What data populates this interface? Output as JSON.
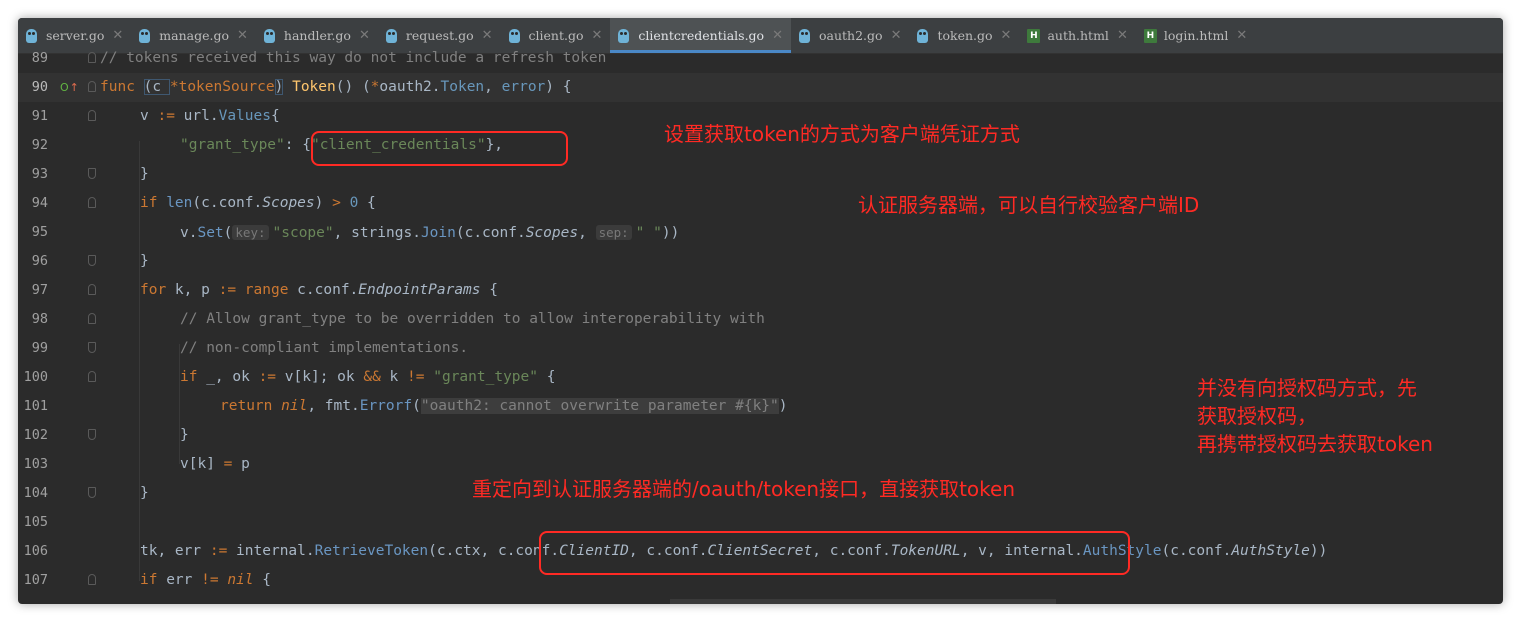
{
  "tabs": [
    {
      "label": "server.go",
      "type": "go"
    },
    {
      "label": "manage.go",
      "type": "go"
    },
    {
      "label": "handler.go",
      "type": "go"
    },
    {
      "label": "request.go",
      "type": "go"
    },
    {
      "label": "client.go",
      "type": "go"
    },
    {
      "label": "clientcredentials.go",
      "type": "go",
      "active": true
    },
    {
      "label": "oauth2.go",
      "type": "go"
    },
    {
      "label": "token.go",
      "type": "go"
    },
    {
      "label": "auth.html",
      "type": "html"
    },
    {
      "label": "login.html",
      "type": "html"
    }
  ],
  "tab_close_glyph": "✕",
  "lines": {
    "n89": "89",
    "n90": "90",
    "n91": "91",
    "n92": "92",
    "n93": "93",
    "n94": "94",
    "n95": "95",
    "n96": "96",
    "n97": "97",
    "n98": "98",
    "n99": "99",
    "n100": "100",
    "n101": "101",
    "n102": "102",
    "n103": "103",
    "n104": "104",
    "n105": "105",
    "n106": "106",
    "n107": "107"
  },
  "code": {
    "l89_comment": "// tokens received this way do not include a refresh token",
    "l90_func": "func",
    "l90_recv_open": "(c ",
    "l90_star": "*",
    "l90_recv_type": "tokenSource",
    "l90_recv_close": ")",
    "l90_name": "Token",
    "l90_rest_a": "() (",
    "l90_star2": "*",
    "l90_pkg": "oauth2.",
    "l90_type": "Token",
    "l90_rest_b": ", ",
    "l90_err": "error",
    "l90_rest_c": ") {",
    "l91_a": "v ",
    "l91_op": ":=",
    "l91_b": " url.",
    "l91_type": "Values",
    "l91_c": "{",
    "l92_key": "\"grant_type\"",
    "l92_colon": ": ",
    "l92_val_open": "{",
    "l92_val": "\"client_credentials\"",
    "l92_val_close": "},",
    "l93": "}",
    "l94_if": "if ",
    "l94_len": "len",
    "l94_a": "(c.conf.",
    "l94_scopes": "Scopes",
    "l94_b": ") ",
    "l94_gt": ">",
    "l94_zero": " 0",
    "l94_c": " {",
    "l95_a": "v.",
    "l95_set": "Set",
    "l95_b": "(",
    "l95_hint_key": "key:",
    "l95_scope": "\"scope\"",
    "l95_c": ", strings.",
    "l95_join": "Join",
    "l95_d": "(c.conf.",
    "l95_scopes": "Scopes",
    "l95_e": ", ",
    "l95_hint_sep": "sep:",
    "l95_space": "\" \"",
    "l95_f": "))",
    "l96": "}",
    "l97_for": "for",
    "l97_a": " k, p ",
    "l97_op": ":=",
    "l97_range": " range",
    "l97_b": " c.conf.",
    "l97_ep": "EndpointParams",
    "l97_c": " {",
    "l98": "// Allow grant_type to be overridden to allow interoperability with",
    "l99": "// non-compliant implementations.",
    "l100_if": "if",
    "l100_a": " _, ok ",
    "l100_op": ":=",
    "l100_b": " v[k]; ok ",
    "l100_and": "&&",
    "l100_c": " k ",
    "l100_ne": "!=",
    "l100_d": " ",
    "l100_str": "\"grant_type\"",
    "l100_e": " {",
    "l101_ret": "return",
    "l101_a": " ",
    "l101_nil": "nil",
    "l101_b": ", fmt.",
    "l101_errorf": "Errorf",
    "l101_c": "(",
    "l101_str": "\"oauth2: cannot overwrite parameter #{k}\"",
    "l101_d": ")",
    "l102": "}",
    "l103_a": "v[k] ",
    "l103_op": "=",
    "l103_b": " p",
    "l104": "}",
    "l106_a": "tk, err ",
    "l106_op": ":=",
    "l106_b": " internal.",
    "l106_fn": "RetrieveToken",
    "l106_c": "(c.ctx, c.conf.",
    "l106_cid": "ClientID",
    "l106_d": ", c.conf.",
    "l106_cs": "ClientSecret",
    "l106_e": ", c.conf.",
    "l106_turl": "TokenURL",
    "l106_f": ", v, internal.",
    "l106_as": "AuthStyle",
    "l106_g": "(c.conf.",
    "l106_as2": "AuthStyle",
    "l106_h": "))",
    "l107_if": "if",
    "l107_a": " err ",
    "l107_ne": "!=",
    "l107_b": " ",
    "l107_nil": "nil",
    "l107_c": " {"
  },
  "gutter": {
    "implements_mark": "O",
    "up_arrow": "↑"
  },
  "annotations": {
    "a1": "设置获取token的方式为客户端凭证方式",
    "a2": "认证服务器端，可以自行校验客户端ID",
    "a3_l1": "并没有向授权码方式，先",
    "a3_l2": "获取授权码，",
    "a3_l3": "再携带授权码去获取token",
    "a4": "重定向到认证服务器端的/oauth/token接口，直接获取token"
  },
  "colors": {
    "keyword": "#cc7832",
    "string": "#6a8759",
    "type": "#6897bb",
    "function": "#ffc66d",
    "comment": "#808080",
    "annotation": "#ff2a24",
    "editor_bg": "#2b2b2b",
    "tab_accent": "#4a88c7"
  }
}
